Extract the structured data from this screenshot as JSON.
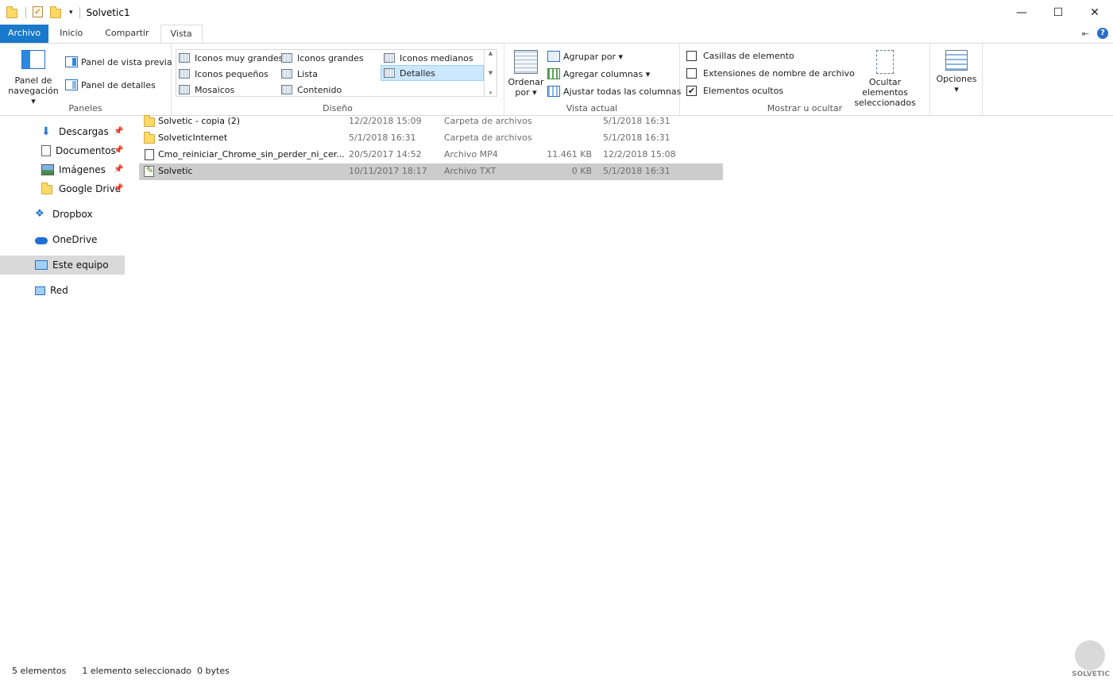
{
  "window": {
    "title": "Solvetic1",
    "minimize": "—",
    "maximize": "☐",
    "close": "✕"
  },
  "qat": {
    "dropdown": "▾"
  },
  "tabs": [
    {
      "label": "Archivo"
    },
    {
      "label": "Inicio"
    },
    {
      "label": "Compartir"
    },
    {
      "label": "Vista"
    }
  ],
  "ribbon": {
    "panes": {
      "nav_pane_label_1": "Panel de",
      "nav_pane_label_2": "navegación ▾",
      "preview_pane": "Panel de vista previa",
      "details_pane": "Panel de detalles",
      "group": "Paneles"
    },
    "layout": {
      "items": [
        "Iconos muy grandes",
        "Iconos grandes",
        "Iconos medianos",
        "Iconos pequeños",
        "Lista",
        "Detalles",
        "Mosaicos",
        "Contenido"
      ],
      "selected": "Detalles",
      "group": "Diseño"
    },
    "current_view": {
      "sort_by_1": "Ordenar",
      "sort_by_2": "por ▾",
      "group_by": "Agrupar por ▾",
      "add_columns": "Agregar columnas ▾",
      "fit_columns": "Ajustar todas las columnas",
      "group": "Vista actual"
    },
    "show_hide": {
      "item_checkboxes": "Casillas de elemento",
      "file_extensions": "Extensiones de nombre de archivo",
      "hidden_items": "Elementos ocultos",
      "hide_selected_1": "Ocultar elementos",
      "hide_selected_2": "seleccionados",
      "group": "Mostrar u ocultar",
      "check_mark": "✔",
      "item_checkboxes_checked": false,
      "file_extensions_checked": false,
      "hidden_items_checked": true
    },
    "options": {
      "label": "Opciones",
      "dropdown": "▾"
    }
  },
  "nav": {
    "items": [
      {
        "label": "Descargas",
        "pinned": true
      },
      {
        "label": "Documentos",
        "pinned": true
      },
      {
        "label": "Imágenes",
        "pinned": true
      },
      {
        "label": "Google Drive",
        "pinned": true
      },
      {
        "label": "Dropbox"
      },
      {
        "label": "OneDrive"
      },
      {
        "label": "Este equipo",
        "selected": true
      },
      {
        "label": "Red"
      }
    ],
    "pin_glyph": "📌"
  },
  "files": [
    {
      "name": "Solvetic - copia (2)",
      "date": "12/2/2018 15:09",
      "type": "Carpeta de archivos",
      "size": "",
      "date2": "5/1/2018 16:31",
      "icon": "folder-icon"
    },
    {
      "name": "SolveticInternet",
      "date": "5/1/2018 16:31",
      "type": "Carpeta de archivos",
      "size": "",
      "date2": "5/1/2018 16:31",
      "icon": "folder-icon"
    },
    {
      "name": "Cmo_reiniciar_Chrome_sin_perder_ni_cer...",
      "date": "20/5/2017 14:52",
      "type": "Archivo MP4",
      "size": "11.461 KB",
      "date2": "12/2/2018 15:08",
      "icon": "file-icon"
    },
    {
      "name": "Solvetic",
      "date": "10/11/2017 18:17",
      "type": "Archivo TXT",
      "size": "0 KB",
      "date2": "5/1/2018 16:31",
      "icon": "text-file-icon",
      "selected": true
    }
  ],
  "status": {
    "count": "5 elementos",
    "selection": "1 elemento seleccionado  0 bytes"
  },
  "watermark": {
    "text": "SOLVETIC"
  },
  "colors": {
    "accent": "#1979ca",
    "selection": "#cccccc",
    "nav_selection": "#d9d9d9",
    "layout_selected": "#cce8ff"
  }
}
